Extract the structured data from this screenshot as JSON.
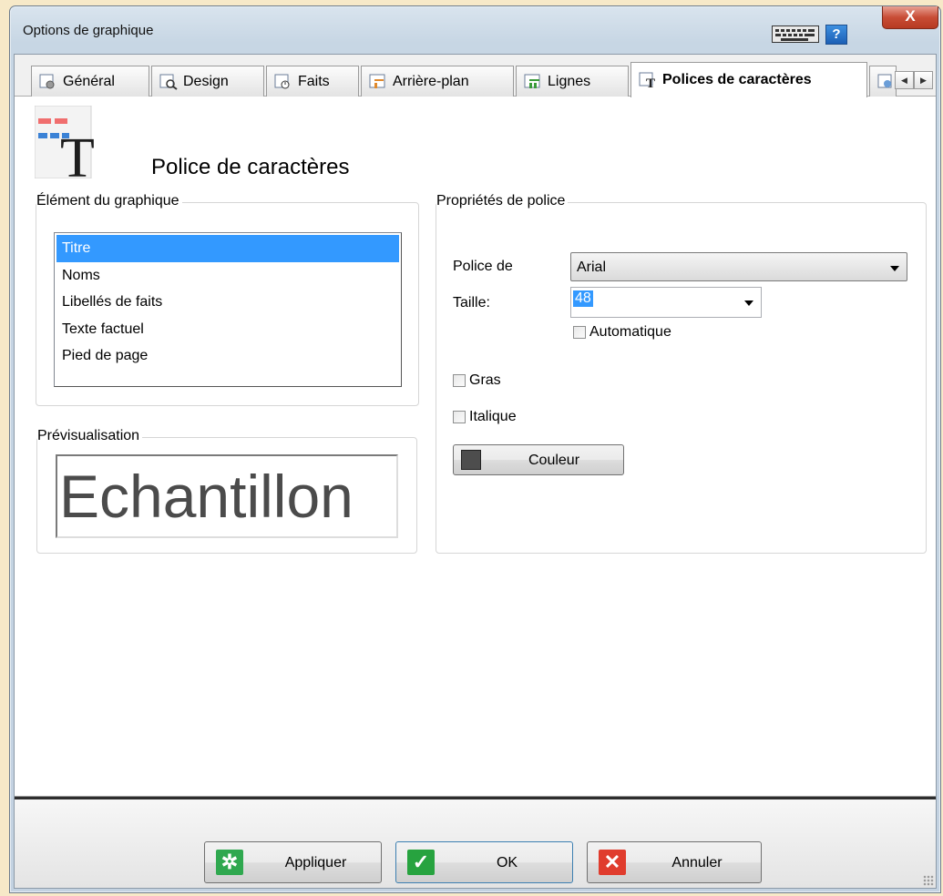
{
  "window": {
    "title": "Options de graphique",
    "close_label": "X",
    "help_label": "?"
  },
  "tabs": [
    {
      "label": "Général",
      "icon": "general-tab-icon"
    },
    {
      "label": "Design",
      "icon": "design-tab-icon"
    },
    {
      "label": "Faits",
      "icon": "facts-tab-icon"
    },
    {
      "label": "Arrière-plan",
      "icon": "background-tab-icon"
    },
    {
      "label": "Lignes",
      "icon": "lines-tab-icon"
    },
    {
      "label": "Polices de caractères",
      "icon": "fonts-tab-icon",
      "active": true
    }
  ],
  "header": {
    "title": "Police de caractères",
    "icon": "font-page-icon"
  },
  "element_group": {
    "label": "Élément du graphique",
    "items": [
      "Titre",
      "Noms",
      "Libellés de faits",
      "Texte factuel",
      "Pied de page"
    ],
    "selected": "Titre"
  },
  "preview_group": {
    "label": "Prévisualisation",
    "sample_text": "Echantillon"
  },
  "font_props": {
    "label": "Propriétés de police",
    "font_label": "Police de",
    "font_value": "Arial",
    "size_label": "Taille:",
    "size_value": "48",
    "auto_label": "Automatique",
    "auto_checked": false,
    "bold_label": "Gras",
    "bold_checked": false,
    "italic_label": "Italique",
    "italic_checked": false,
    "color_label": "Couleur",
    "color_value": "#4d4d4d"
  },
  "footer": {
    "apply_label": "Appliquer",
    "ok_label": "OK",
    "cancel_label": "Annuler"
  },
  "colors": {
    "selection": "#3399ff",
    "apply_icon": "#2fa84f",
    "ok_icon": "#27a33f",
    "cancel_icon": "#e03c2d"
  }
}
